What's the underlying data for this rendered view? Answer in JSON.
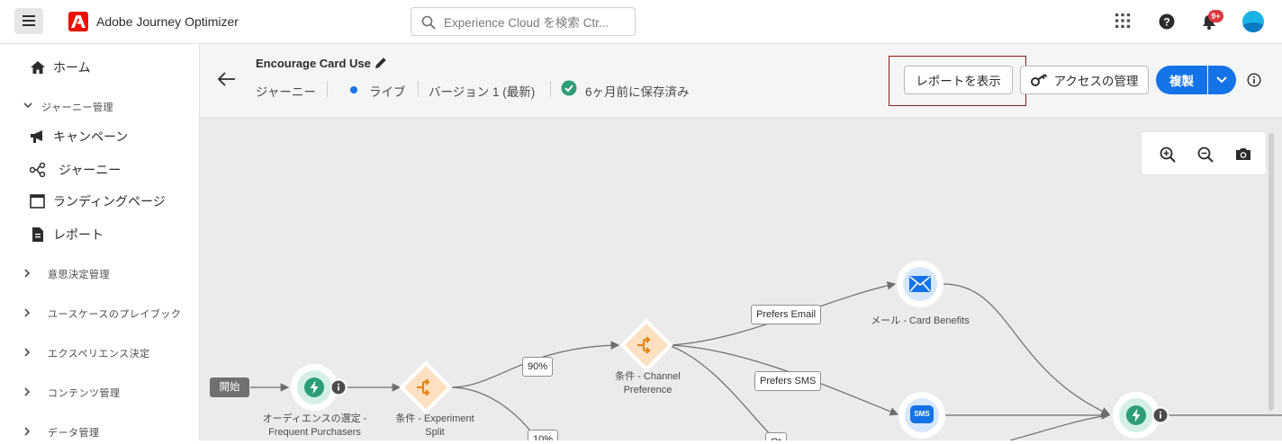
{
  "app": {
    "name": "Adobe Journey Optimizer"
  },
  "search": {
    "placeholder": "Experience Cloud を検索 Ctr..."
  },
  "notifications": {
    "badge": "9+"
  },
  "sidebar": {
    "items": [
      {
        "label": "ホーム",
        "icon": "home-icon"
      },
      {
        "label": "キャンペーン",
        "icon": "megaphone-icon"
      },
      {
        "label": "ジャーニー",
        "icon": "journey-icon"
      },
      {
        "label": "ランディングページ",
        "icon": "landing-page-icon"
      },
      {
        "label": "レポート",
        "icon": "report-icon"
      }
    ],
    "section": "ジャーニー管理",
    "groups": [
      "意思決定管理",
      "ユースケースのプレイブック",
      "エクスペリエンス決定",
      "コンテンツ管理",
      "データ管理"
    ]
  },
  "journey": {
    "title": "Encourage Card Use",
    "type": "ジャーニー",
    "status": "ライブ",
    "version": "バージョン 1 (最新)",
    "saved": "6ヶ月前に保存済み"
  },
  "actions": {
    "report": "レポートを表示",
    "access": "アクセスの管理",
    "duplicate": "複製"
  },
  "canvas": {
    "start": "開始",
    "nodes": {
      "audience": [
        "オーディエンスの選定 -",
        "Frequent Purchasers"
      ],
      "split": [
        "条件 - Experiment",
        "Split"
      ],
      "channel": [
        "条件 - Channel",
        "Preference"
      ],
      "email": "メール - Card Benefits"
    },
    "edges": {
      "p90": "90%",
      "p10": "10%",
      "email": "Prefers Email",
      "sms": "Prefers SMS",
      "other": "Ot"
    },
    "sms_glyph": "SMS"
  },
  "colors": {
    "accent": "#1473e6",
    "brand": "#eb1000",
    "condition": "#e68619",
    "audience": "#2d9d78"
  }
}
